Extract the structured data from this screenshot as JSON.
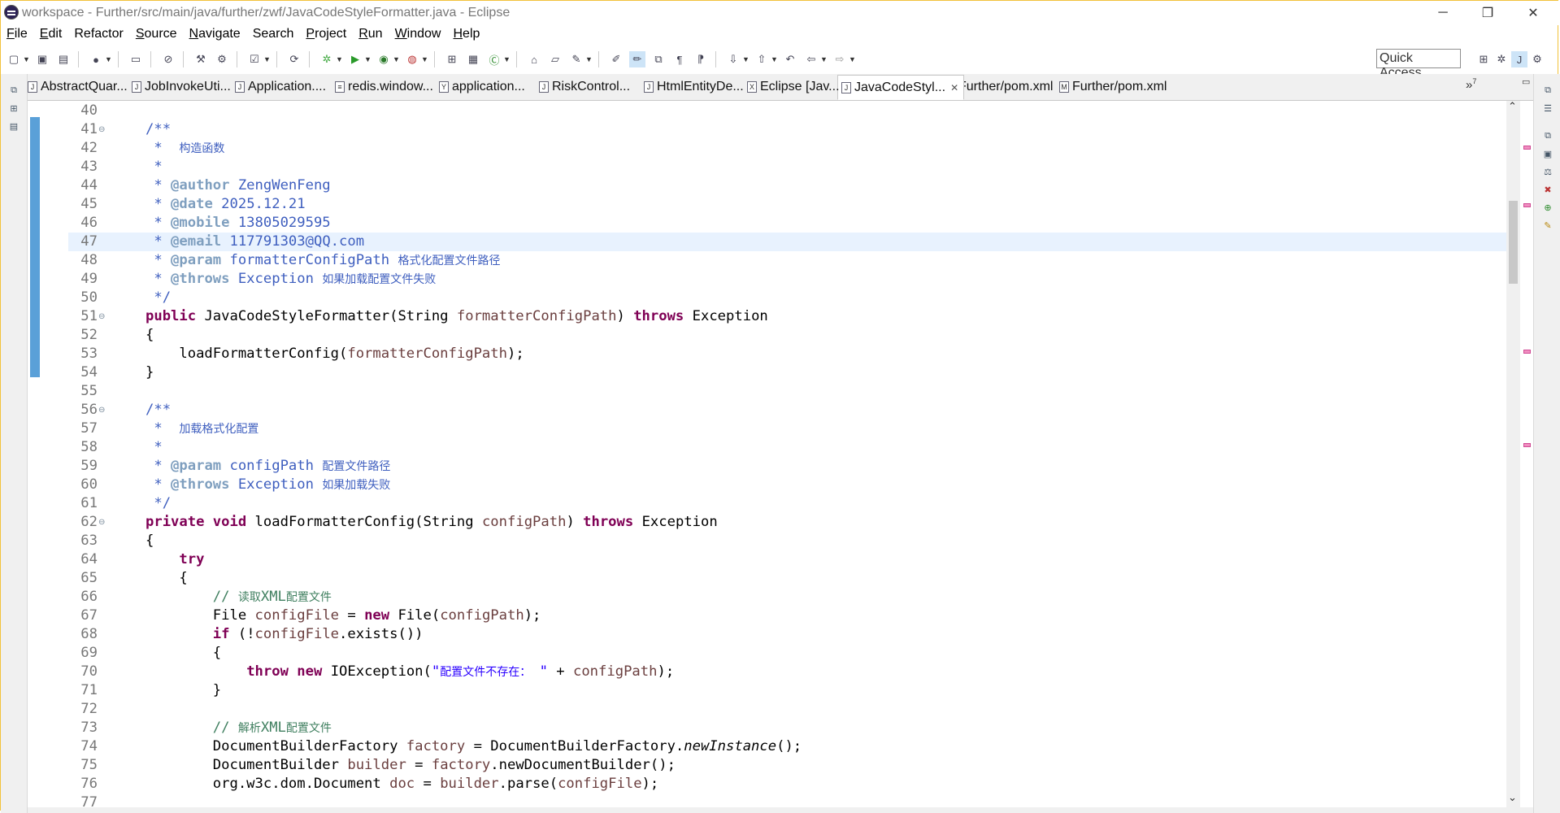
{
  "window": {
    "title": "workspace - Further/src/main/java/further/zwf/JavaCodeStyleFormatter.java - Eclipse",
    "controls": [
      "─",
      "❐",
      "✕"
    ]
  },
  "menu": [
    {
      "mn": "F",
      "rest": "ile"
    },
    {
      "mn": "E",
      "rest": "dit"
    },
    {
      "mn": "",
      "rest": "Refactor"
    },
    {
      "mn": "S",
      "rest": "ource"
    },
    {
      "mn": "N",
      "rest": "avigate"
    },
    {
      "mn": "",
      "rest": "Search"
    },
    {
      "mn": "P",
      "rest": "roject"
    },
    {
      "mn": "R",
      "rest": "un"
    },
    {
      "mn": "W",
      "rest": "indow"
    },
    {
      "mn": "H",
      "rest": "elp"
    }
  ],
  "quick_access": "Quick Access",
  "tabs": [
    {
      "label": "AbstractQuar...",
      "icon": "J"
    },
    {
      "label": "JobInvokeUti...",
      "icon": "J"
    },
    {
      "label": "Application....",
      "icon": "J"
    },
    {
      "label": "redis.window...",
      "icon": "≡"
    },
    {
      "label": "application...",
      "icon": "Y"
    },
    {
      "label": "RiskControl...",
      "icon": "J"
    },
    {
      "label": "HtmlEntityDe...",
      "icon": "J"
    },
    {
      "label": "Eclipse [Jav...",
      "icon": "X"
    },
    {
      "label": "JavaCodeStyl...",
      "icon": "J",
      "active": true
    },
    {
      "label": "Further/pom.xml",
      "icon": "M"
    },
    {
      "label": "Further/pom.xml",
      "icon": "M"
    }
  ],
  "tabs_more": "»",
  "tabs_more_count": "7",
  "code_lines": [
    {
      "n": "40",
      "html": ""
    },
    {
      "n": "41",
      "fold": true,
      "html": "<span class='jd'>/**</span>"
    },
    {
      "n": "42",
      "html": "<span class='jd'> *  <span class='cjk'>构造函数</span></span>"
    },
    {
      "n": "43",
      "html": "<span class='jd'> *</span>"
    },
    {
      "n": "44",
      "html": "<span class='jd'> * <span class='jdt'>@author</span> ZengWenFeng</span>"
    },
    {
      "n": "45",
      "html": "<span class='jd'> * <span class='jdt'>@date</span> 2025.12.21</span>"
    },
    {
      "n": "46",
      "html": "<span class='jd'> * <span class='jdt'>@mobile</span> 13805029595</span>"
    },
    {
      "n": "47",
      "hl": true,
      "html": "<span class='jd'> * <span class='jdt'>@email</span> 117791303@QQ.com</span>"
    },
    {
      "n": "48",
      "html": "<span class='jd'> * <span class='jdt'>@param</span> formatterConfigPath <span class='cjk'>格式化配置文件路径</span></span>"
    },
    {
      "n": "49",
      "html": "<span class='jd'> * <span class='jdt'>@throws</span> Exception <span class='cjk'>如果加载配置文件失败</span></span>"
    },
    {
      "n": "50",
      "html": "<span class='jd'> */</span>"
    },
    {
      "n": "51",
      "fold": true,
      "html": "<span class='kw'>public</span> JavaCodeStyleFormatter(String <span class='var'>formatterConfigPath</span>) <span class='kw'>throws</span> Exception"
    },
    {
      "n": "52",
      "html": "{"
    },
    {
      "n": "53",
      "html": "    loadFormatterConfig(<span class='var'>formatterConfigPath</span>);"
    },
    {
      "n": "54",
      "html": "}"
    },
    {
      "n": "55",
      "html": ""
    },
    {
      "n": "56",
      "fold": true,
      "html": "<span class='jd'>/**</span>"
    },
    {
      "n": "57",
      "html": "<span class='jd'> *  <span class='cjk'>加载格式化配置</span></span>"
    },
    {
      "n": "58",
      "html": "<span class='jd'> *</span>"
    },
    {
      "n": "59",
      "html": "<span class='jd'> * <span class='jdt'>@param</span> configPath <span class='cjk'>配置文件路径</span></span>"
    },
    {
      "n": "60",
      "html": "<span class='jd'> * <span class='jdt'>@throws</span> Exception <span class='cjk'>如果加载失败</span></span>"
    },
    {
      "n": "61",
      "html": "<span class='jd'> */</span>"
    },
    {
      "n": "62",
      "fold": true,
      "html": "<span class='kw'>private</span> <span class='kw'>void</span> loadFormatterConfig(String <span class='var'>configPath</span>) <span class='kw'>throws</span> Exception"
    },
    {
      "n": "63",
      "html": "{"
    },
    {
      "n": "64",
      "html": "    <span class='kw'>try</span>"
    },
    {
      "n": "65",
      "html": "    {"
    },
    {
      "n": "66",
      "html": "        <span class='cmt'>// <span class='cjk'>读取</span>XML<span class='cjk'>配置文件</span></span>"
    },
    {
      "n": "67",
      "html": "        File <span class='var'>configFile</span> = <span class='kw'>new</span> File(<span class='var'>configPath</span>);"
    },
    {
      "n": "68",
      "html": "        <span class='kw'>if</span> (!<span class='var'>configFile</span>.exists())"
    },
    {
      "n": "69",
      "html": "        {"
    },
    {
      "n": "70",
      "html": "            <span class='kw'>throw</span> <span class='kw'>new</span> IOException(<span class='str'>\"<span class='cjk'>配置文件不存在：</span> \"</span> + <span class='var'>configPath</span>);"
    },
    {
      "n": "71",
      "html": "        }"
    },
    {
      "n": "72",
      "html": ""
    },
    {
      "n": "73",
      "html": "        <span class='cmt'>// <span class='cjk'>解析</span>XML<span class='cjk'>配置文件</span></span>"
    },
    {
      "n": "74",
      "html": "        DocumentBuilderFactory <span class='var'>factory</span> = DocumentBuilderFactory.<span class='it'>newInstance</span>();"
    },
    {
      "n": "75",
      "html": "        DocumentBuilder <span class='var'>builder</span> = <span class='var'>factory</span>.newDocumentBuilder();"
    },
    {
      "n": "76",
      "html": "        org.w3c.dom.Document <span class='var'>doc</span> = <span class='var'>builder</span>.parse(<span class='var'>configFile</span>);"
    },
    {
      "n": "77",
      "html": ""
    }
  ]
}
